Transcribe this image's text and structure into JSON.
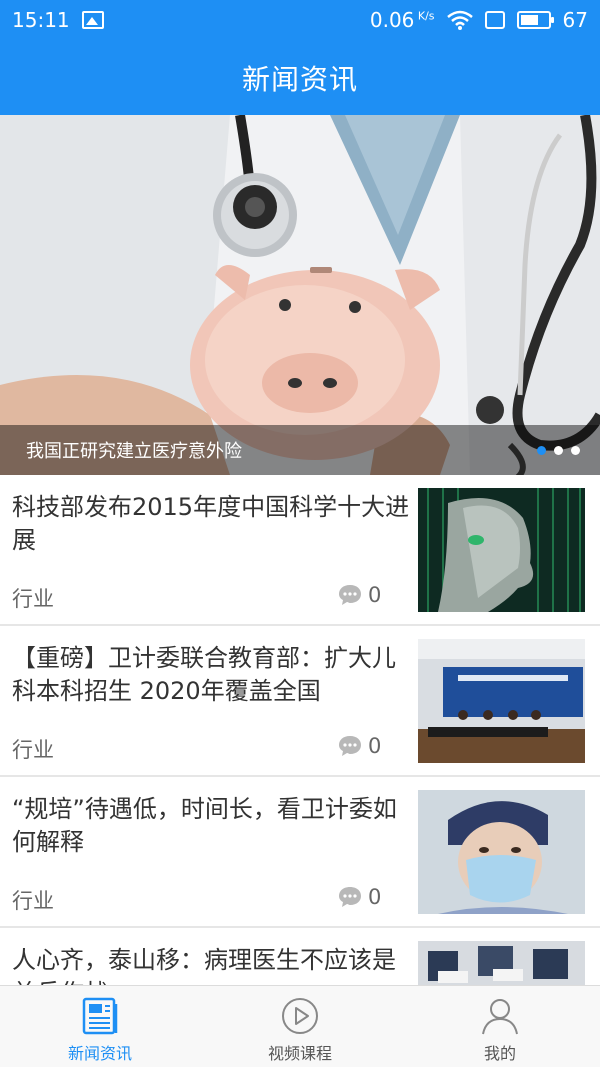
{
  "status_bar": {
    "time": "15:11",
    "speed": "0.06",
    "speed_unit": "K/s",
    "battery": "67"
  },
  "header": {
    "title": "新闻资讯"
  },
  "banner": {
    "caption": "我国正研究建立医疗意外险",
    "dots": 3,
    "active_dot": 1
  },
  "news": [
    {
      "title": "科技部发布2015年度中国科学十大进展",
      "tag": "行业",
      "comments": "0",
      "thumb": "face-matrix"
    },
    {
      "title": "【重磅】卫计委联合教育部：扩大儿科本科招生 2020年覆盖全国",
      "tag": "行业",
      "comments": "0",
      "thumb": "press-conference"
    },
    {
      "title": "“规培”待遇低，时间长，看卫计委如何解释",
      "tag": "行业",
      "comments": "0",
      "thumb": "nurse-mask"
    },
    {
      "title": "人心齐，泰山移：病理医生不应该是单兵作战",
      "tag": "",
      "comments": "",
      "thumb": "meeting"
    }
  ],
  "tabs": [
    {
      "label": "新闻资讯",
      "icon": "news-icon",
      "active": true
    },
    {
      "label": "视频课程",
      "icon": "video-play-icon",
      "active": false
    },
    {
      "label": "我的",
      "icon": "user-icon",
      "active": false
    }
  ],
  "colors": {
    "accent": "#1E8FF4"
  }
}
